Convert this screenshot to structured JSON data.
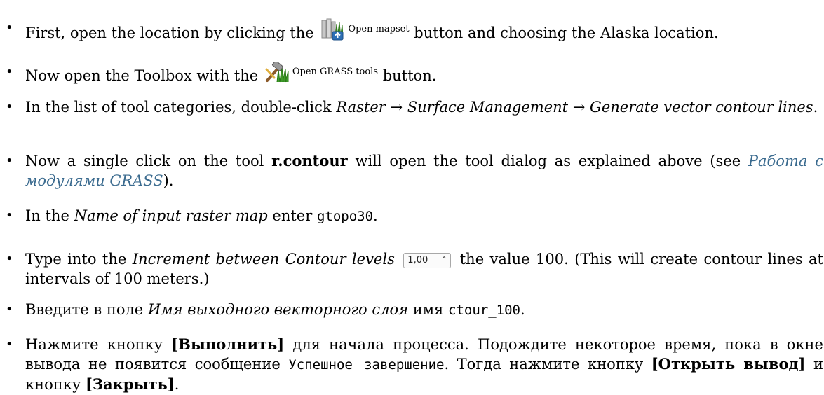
{
  "steps": [
    {
      "before": "First, open the location by clicking the",
      "icon": "open-mapset-icon",
      "button_label": "Open mapset",
      "after": "button and choosing the Alaska location."
    },
    {
      "before": "Now open the Toolbox with the",
      "icon": "grass-tools-icon",
      "button_label": "Open GRASS tools",
      "after": "button."
    },
    {
      "before": "In the list of tool categories, double-click",
      "path": "Raster → Surface Management → Generate vector contour lines",
      "after": "."
    },
    {
      "before": "Now a single click on the tool",
      "tool": "r.contour",
      "middle": "will open the tool dialog as explained above (see",
      "link": "Работа с модулями GRASS",
      "after": ")."
    },
    {
      "before": "In the",
      "field": "Name of input raster map",
      "middle": "enter",
      "value": "gtopo30",
      "after": "."
    },
    {
      "before": "Type into the",
      "field": "Increment between Contour levels",
      "spin_value": "1,00",
      "middle": "the value 100. (This will create contour lines at intervals of 100 meters.)"
    },
    {
      "before": "Введите в поле",
      "field": "Имя выходного векторного слоя",
      "middle": "имя",
      "value": "ctour_100",
      "after": "."
    },
    {
      "before": "Нажмите кнопку",
      "run_button": "[Выполнить]",
      "middle": "для начала процесса. Подождите некоторое время, пока в окне вывода не появится сообщение",
      "message": "Успешное завершение",
      "middle2": ". Тогда нажмите кнопку",
      "open_button": "[Открыть вывод]",
      "middle3": "и кнопку",
      "close_button": "[Закрыть]",
      "after": "."
    }
  ],
  "colors": {
    "link": "#3b6b8f",
    "text": "#000000"
  }
}
